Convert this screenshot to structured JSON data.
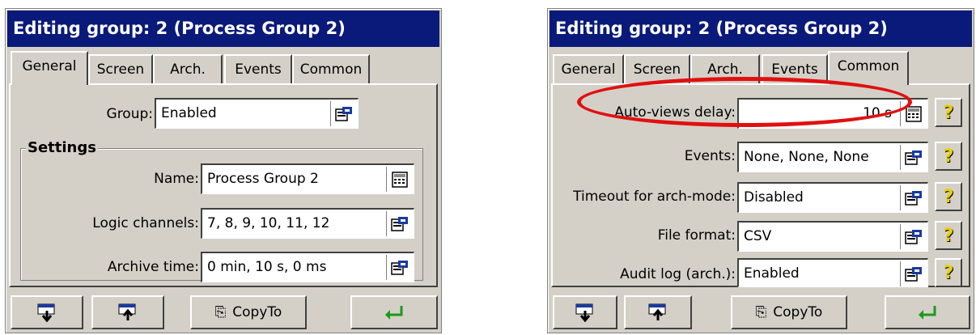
{
  "left": {
    "title": "Editing group: 2 (Process Group 2)",
    "tabs": [
      "General",
      "Screen",
      "Arch.",
      "Events",
      "Common"
    ],
    "group_label": "Group:",
    "group_value": "Enabled",
    "settings_title": "Settings",
    "name_label": "Name:",
    "name_value": "Process Group 2",
    "logic_label": "Logic channels:",
    "logic_value": "7, 8, 9, 10, 11, 12",
    "archive_label": "Archive time:",
    "archive_value": "0 min, 10 s, 0 ms",
    "copy_label": "CopyTo"
  },
  "right": {
    "title": "Editing group: 2 (Process Group 2)",
    "tabs": [
      "General",
      "Screen",
      "Arch.",
      "Events",
      "Common"
    ],
    "rows": [
      {
        "label": "Auto-views delay:",
        "value": "10 s"
      },
      {
        "label": "Events:",
        "value": "None, None, None"
      },
      {
        "label": "Timeout for arch-mode:",
        "value": "Disabled"
      },
      {
        "label": "File format:",
        "value": "CSV"
      },
      {
        "label": "Audit log (arch.):",
        "value": "Enabled"
      }
    ],
    "copy_label": "CopyTo"
  },
  "colors": {
    "title_bg": "#0a1a7a",
    "highlight": "#e01010",
    "enter_arrow": "#1a9a1a",
    "help_icon": "#e8d000"
  }
}
